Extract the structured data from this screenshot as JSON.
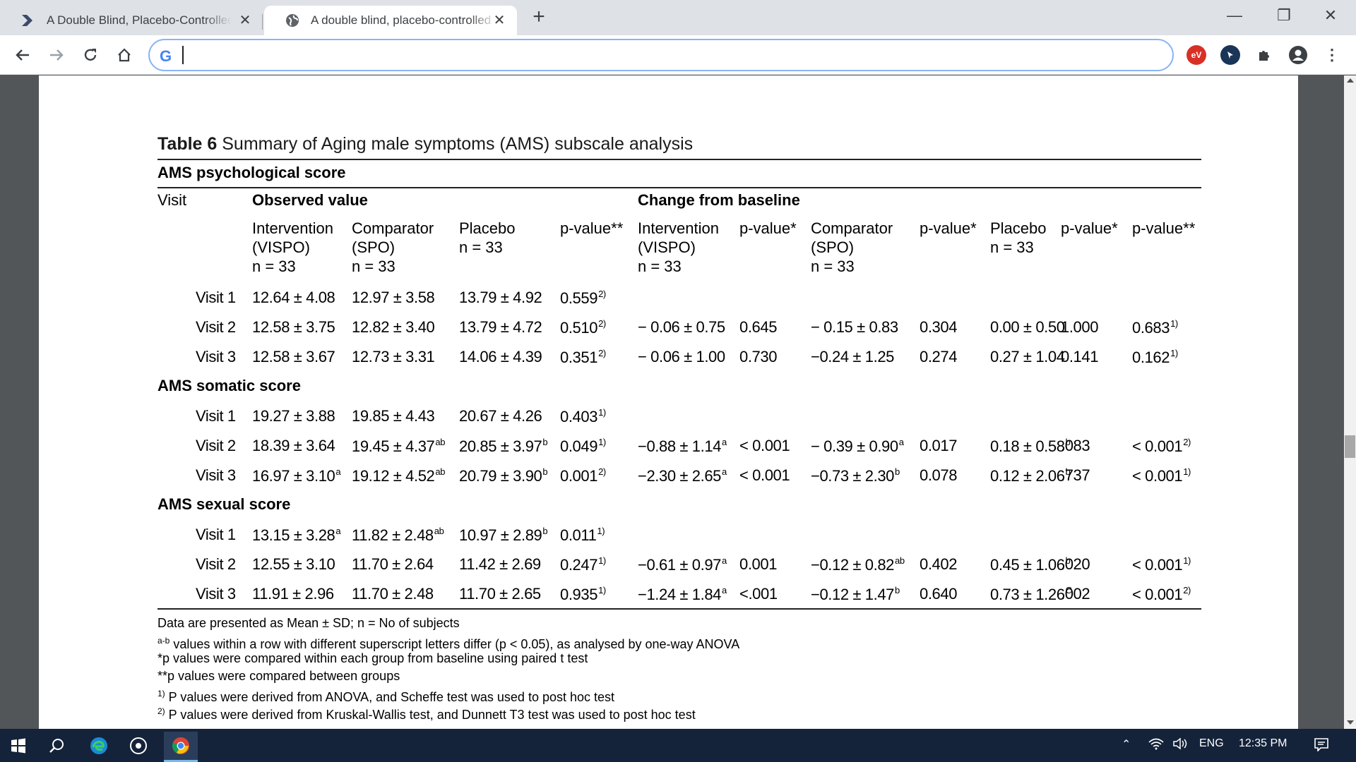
{
  "browser": {
    "tabs": [
      {
        "title": "A Double Blind, Placebo-Controlled",
        "active": false
      },
      {
        "title": "A double blind, placebo-controlled",
        "active": true
      }
    ],
    "address_value": "",
    "accent": "#8ab4f8"
  },
  "table": {
    "title_bold": "Table 6",
    "title_rest": " Summary of Aging male symptoms (AMS) subscale analysis",
    "sections": [
      {
        "label": "AMS psychological score"
      },
      {
        "label": "AMS somatic score"
      },
      {
        "label": "AMS sexual score"
      }
    ],
    "header": {
      "visit": "Visit",
      "observed": "Observed value",
      "change": "Change from baseline",
      "cols": [
        {
          "text": "Intervention\n(VISPO)\nn = 33"
        },
        {
          "text": "Comparator\n(SPO)\nn = 33"
        },
        {
          "text": "Placebo\nn = 33"
        },
        {
          "text": "p-value**"
        },
        {
          "text": "Intervention\n(VISPO)\nn = 33"
        },
        {
          "text": "p-value*"
        },
        {
          "text": "Comparator\n(SPO)\nn = 33"
        },
        {
          "text": "p-value*"
        },
        {
          "text": "Placebo\nn = 33"
        },
        {
          "text": "p-value*"
        },
        {
          "text": "p-value**"
        }
      ]
    },
    "rows": [
      {
        "cells": [
          "Visit 1",
          "12.64 ± 4.08",
          "12.97 ± 3.58",
          "13.79 ± 4.92",
          "0.559",
          "",
          "",
          "",
          "",
          "",
          "",
          ""
        ],
        "sups": [
          "",
          "",
          "",
          "",
          "2)",
          "",
          "",
          "",
          "",
          "",
          "",
          ""
        ]
      },
      {
        "cells": [
          "Visit 2",
          "12.58 ± 3.75",
          "12.82 ± 3.40",
          "13.79 ± 4.72",
          "0.510",
          "− 0.06 ± 0.75",
          "0.645",
          "− 0.15 ± 0.83",
          "0.304",
          "0.00 ± 0.50",
          "1.000",
          "0.683"
        ],
        "sups": [
          "",
          "",
          "",
          "",
          "2)",
          "",
          "",
          "",
          "",
          "",
          "",
          "1)"
        ]
      },
      {
        "cells": [
          "Visit 3",
          "12.58 ± 3.67",
          "12.73 ± 3.31",
          "14.06 ± 4.39",
          "0.351",
          "− 0.06 ± 1.00",
          "0.730",
          "−0.24 ± 1.25",
          "0.274",
          "0.27 ± 1.04",
          "0.141",
          "0.162"
        ],
        "sups": [
          "",
          "",
          "",
          "",
          "2)",
          "",
          "",
          "",
          "",
          "",
          "",
          "1)"
        ]
      },
      {
        "cells": [
          "Visit 1",
          "19.27 ± 3.88",
          "19.85 ± 4.43",
          "20.67 ± 4.26",
          "0.403",
          "",
          "",
          "",
          "",
          "",
          "",
          ""
        ],
        "sups": [
          "",
          "",
          "",
          "",
          "1)",
          "",
          "",
          "",
          "",
          "",
          "",
          ""
        ]
      },
      {
        "cells": [
          "Visit 2",
          "18.39 ± 3.64",
          "19.45 ± 4.37",
          "20.85 ± 3.97",
          "0.049",
          "−0.88 ± 1.14",
          "< 0.001",
          "− 0.39 ± 0.90",
          "0.017",
          "0.18 ± 0.58",
          ".083",
          "< 0.001"
        ],
        "sups": [
          "",
          "",
          "ab",
          "b",
          "1)",
          "a",
          "",
          "a",
          "",
          "b",
          "",
          "2)"
        ]
      },
      {
        "cells": [
          "Visit 3",
          "16.97 ± 3.10",
          "19.12 ± 4.52",
          "20.79 ± 3.90",
          "0.001",
          "−2.30 ± 2.65",
          "< 0.001",
          "−0.73 ± 2.30",
          "0.078",
          "0.12 ± 2.06",
          ".737",
          "< 0.001"
        ],
        "sups": [
          "",
          "a",
          "ab",
          "b",
          "2)",
          "a",
          "",
          "b",
          "",
          "b",
          "",
          "1)"
        ]
      },
      {
        "cells": [
          "Visit 1",
          "13.15 ± 3.28",
          "11.82 ± 2.48",
          "10.97 ± 2.89",
          "0.011",
          "",
          "",
          "",
          "",
          "",
          "",
          ""
        ],
        "sups": [
          "",
          "a",
          "ab",
          "b",
          "1)",
          "",
          "",
          "",
          "",
          "",
          "",
          ""
        ]
      },
      {
        "cells": [
          "Visit 2",
          "12.55 ± 3.10",
          "11.70 ± 2.64",
          "11.42 ± 2.69",
          "0.247",
          "−0.61 ± 0.97",
          "0.001",
          "−0.12 ± 0.82",
          "0.402",
          "0.45 ± 1.06",
          ".020",
          "< 0.001"
        ],
        "sups": [
          "",
          "",
          "",
          "",
          "1)",
          "a",
          "",
          "ab",
          "",
          "b",
          "",
          "1)"
        ]
      },
      {
        "cells": [
          "Visit 3",
          "11.91 ± 2.96",
          "11.70 ± 2.48",
          "11.70 ± 2.65",
          "0.935",
          "−1.24 ± 1.84",
          "<.001",
          "−0.12 ± 1.47",
          "0.640",
          "0.73 ± 1.26",
          ".002",
          "< 0.001"
        ],
        "sups": [
          "",
          "",
          "",
          "",
          "1)",
          "a",
          "",
          "b",
          "",
          "C",
          "",
          "2)"
        ]
      }
    ],
    "footnotes": [
      {
        "sup": "",
        "text": "Data are presented as Mean ± SD; n = No of subjects"
      },
      {
        "sup": "a-b",
        "text": " values within a row with different superscript letters differ (p < 0.05), as analysed by one-way ANOVA"
      },
      {
        "sup": "",
        "text": "*p values were compared within each group from baseline using paired t test"
      },
      {
        "sup": "",
        "text": "**p values were compared between groups"
      },
      {
        "sup": "1)",
        "text": " P values were derived from ANOVA, and Scheffe test was used to post hoc test"
      },
      {
        "sup": "2)",
        "text": " P values were derived from Kruskal-Wallis test, and Dunnett T3 test was used to post hoc test"
      }
    ]
  },
  "taskbar": {
    "language": "ENG",
    "time": "12:35 PM"
  }
}
